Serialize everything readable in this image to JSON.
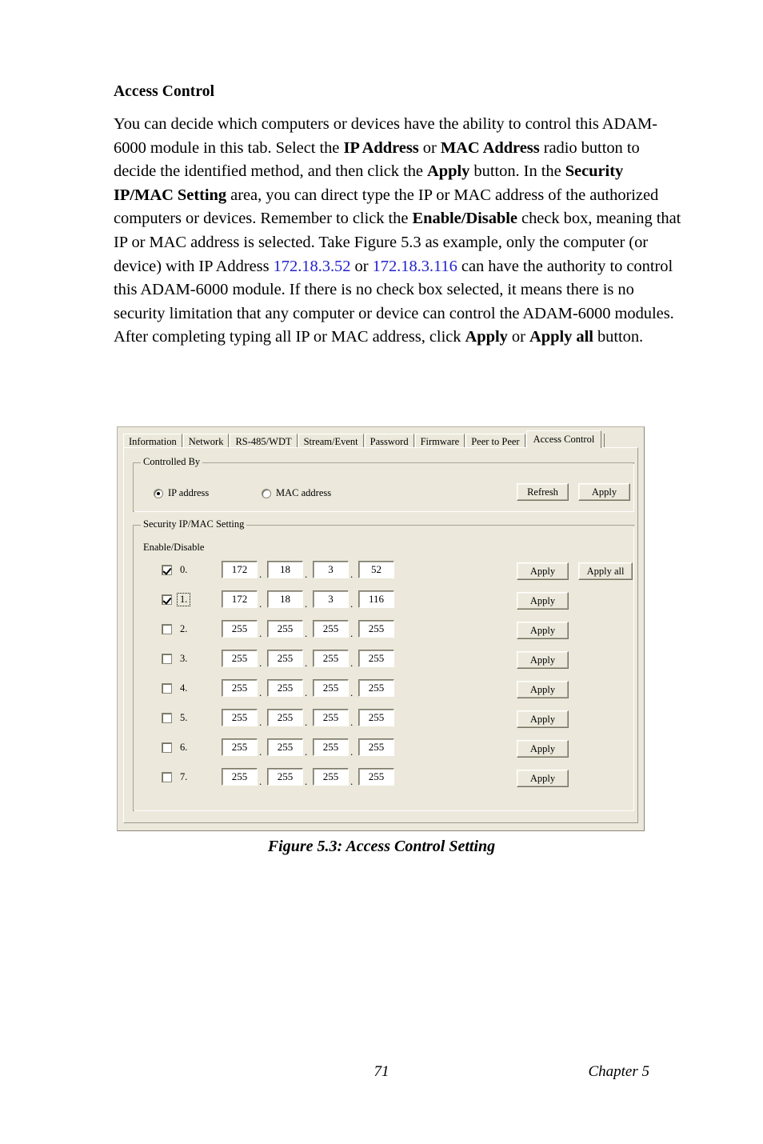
{
  "document": {
    "heading": "Access Control",
    "paragraph_runs": [
      {
        "text": "You can decide which computers or devices have the ability to control this ADAM-6000 module in this tab. Select the ",
        "style": "normal"
      },
      {
        "text": "IP Address",
        "style": "bold"
      },
      {
        "text": " or ",
        "style": "normal"
      },
      {
        "text": "MAC Address",
        "style": "bold"
      },
      {
        "text": " radio button to decide the identified method, and then click the ",
        "style": "normal"
      },
      {
        "text": "Apply",
        "style": "bold"
      },
      {
        "text": " button. In the ",
        "style": "normal"
      },
      {
        "text": "Security IP/MAC Setting",
        "style": "bold"
      },
      {
        "text": " area, you can direct type the IP or MAC address of the authorized computers or devices. Remember to click the ",
        "style": "normal"
      },
      {
        "text": "Enable/Disable",
        "style": "bold"
      },
      {
        "text": " check box, meaning that IP or MAC address is selected. Take Figure 5.3 as example, only the computer (or device) with IP Address ",
        "style": "normal"
      },
      {
        "text": "172.18.3.52",
        "style": "link"
      },
      {
        "text": " or ",
        "style": "normal"
      },
      {
        "text": "172.18.3.116",
        "style": "link"
      },
      {
        "text": " can have the authority to control this ADAM-6000 module. If there is no check box selected, it means there is no security limitation that any computer or device can control the ADAM-6000 modules. After completing typing all IP or MAC address, click ",
        "style": "normal"
      },
      {
        "text": "Apply",
        "style": "bold"
      },
      {
        "text": " or ",
        "style": "normal"
      },
      {
        "text": "Apply all",
        "style": "bold"
      },
      {
        "text": " button.",
        "style": "normal"
      }
    ],
    "figure_caption": "Figure 5.3: Access Control Setting",
    "footer_page_number": "71",
    "footer_chapter": "Chapter 5",
    "link_color": "#2222CC"
  },
  "dialog": {
    "background_color": "#ECE9DC",
    "tabs": [
      {
        "label": "Information",
        "selected": false
      },
      {
        "label": "Network",
        "selected": false
      },
      {
        "label": "RS-485/WDT",
        "selected": false
      },
      {
        "label": "Stream/Event",
        "selected": false
      },
      {
        "label": "Password",
        "selected": false
      },
      {
        "label": "Firmware",
        "selected": false
      },
      {
        "label": "Peer to Peer",
        "selected": false
      },
      {
        "label": "Access Control",
        "selected": true
      }
    ],
    "controlled_by": {
      "group_title": "Controlled By",
      "radios": [
        {
          "label": "IP address",
          "selected": true
        },
        {
          "label": "MAC address",
          "selected": false
        }
      ],
      "refresh_label": "Refresh",
      "apply_label": "Apply"
    },
    "security": {
      "group_title": "Security IP/MAC Setting",
      "enable_disable_label": "Enable/Disable",
      "apply_all_label": "Apply all",
      "apply_label": "Apply",
      "rows": [
        {
          "index_label": "0.",
          "checked": true,
          "focused": false,
          "octets": [
            "172",
            "18",
            "3",
            "52"
          ],
          "apply_label": "Apply"
        },
        {
          "index_label": "1.",
          "checked": true,
          "focused": true,
          "octets": [
            "172",
            "18",
            "3",
            "116"
          ],
          "apply_label": "Apply"
        },
        {
          "index_label": "2.",
          "checked": false,
          "focused": false,
          "octets": [
            "255",
            "255",
            "255",
            "255"
          ],
          "apply_label": "Apply"
        },
        {
          "index_label": "3.",
          "checked": false,
          "focused": false,
          "octets": [
            "255",
            "255",
            "255",
            "255"
          ],
          "apply_label": "Apply"
        },
        {
          "index_label": "4.",
          "checked": false,
          "focused": false,
          "octets": [
            "255",
            "255",
            "255",
            "255"
          ],
          "apply_label": "Apply"
        },
        {
          "index_label": "5.",
          "checked": false,
          "focused": false,
          "octets": [
            "255",
            "255",
            "255",
            "255"
          ],
          "apply_label": "Apply"
        },
        {
          "index_label": "6.",
          "checked": false,
          "focused": false,
          "octets": [
            "255",
            "255",
            "255",
            "255"
          ],
          "apply_label": "Apply"
        },
        {
          "index_label": "7.",
          "checked": false,
          "focused": false,
          "octets": [
            "255",
            "255",
            "255",
            "255"
          ],
          "apply_label": "Apply"
        }
      ],
      "separator": "."
    }
  }
}
